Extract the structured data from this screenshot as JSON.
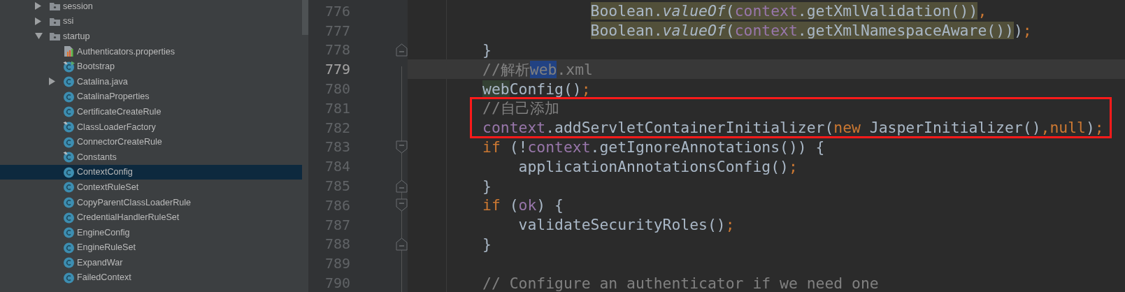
{
  "project_tree": [
    {
      "label": "session",
      "kind": "package",
      "expanded": false,
      "selected": false
    },
    {
      "label": "ssi",
      "kind": "package",
      "expanded": false,
      "selected": false
    },
    {
      "label": "startup",
      "kind": "package",
      "expanded": true,
      "selected": false,
      "children": [
        {
          "label": "Authenticators.properties",
          "kind": "properties",
          "selected": false
        },
        {
          "label": "Bootstrap",
          "kind": "main-class",
          "final": true,
          "selected": false
        },
        {
          "label": "Catalina.java",
          "kind": "class",
          "final": false,
          "expanded": false,
          "selected": false
        },
        {
          "label": "CatalinaProperties",
          "kind": "class",
          "final": false,
          "selected": false
        },
        {
          "label": "CertificateCreateRule",
          "kind": "class",
          "final": false,
          "selected": false
        },
        {
          "label": "ClassLoaderFactory",
          "kind": "class",
          "final": true,
          "selected": false
        },
        {
          "label": "ConnectorCreateRule",
          "kind": "class",
          "final": false,
          "selected": false
        },
        {
          "label": "Constants",
          "kind": "class",
          "final": true,
          "selected": false
        },
        {
          "label": "ContextConfig",
          "kind": "class",
          "final": false,
          "selected": true
        },
        {
          "label": "ContextRuleSet",
          "kind": "class",
          "final": false,
          "selected": false
        },
        {
          "label": "CopyParentClassLoaderRule",
          "kind": "class",
          "final": false,
          "selected": false
        },
        {
          "label": "CredentialHandlerRuleSet",
          "kind": "class",
          "final": false,
          "selected": false
        },
        {
          "label": "EngineConfig",
          "kind": "class",
          "final": false,
          "selected": false
        },
        {
          "label": "EngineRuleSet",
          "kind": "class",
          "final": false,
          "selected": false
        },
        {
          "label": "ExpandWar",
          "kind": "class",
          "final": false,
          "selected": false
        },
        {
          "label": "FailedContext",
          "kind": "class",
          "final": false,
          "selected": false
        }
      ]
    }
  ],
  "editor": {
    "lines": [
      {
        "number": "776",
        "current": false,
        "boxed": false,
        "segments": [
          {
            "t": "                    Boolean.",
            "kind": "plain",
            "color": "#52503a"
          },
          {
            "t": "valueOf",
            "kind": "static",
            "color": "#52503a"
          },
          {
            "t": "(",
            "kind": "plain",
            "color": "#52503a"
          },
          {
            "t": "context",
            "kind": "field",
            "color": "#52503a"
          },
          {
            "t": ".getXmlValidation())",
            "kind": "plain",
            "color": "#52503a"
          },
          {
            "t": ",",
            "kind": "punct"
          }
        ]
      },
      {
        "number": "777",
        "current": false,
        "boxed": false,
        "segments": [
          {
            "t": "                    Boolean.",
            "kind": "plain",
            "color": "#52503a"
          },
          {
            "t": "valueOf",
            "kind": "static",
            "color": "#52503a"
          },
          {
            "t": "(",
            "kind": "plain",
            "color": "#52503a"
          },
          {
            "t": "context",
            "kind": "field",
            "color": "#52503a"
          },
          {
            "t": ".getXmlNamespaceAware())",
            "kind": "plain",
            "color": "#52503a"
          },
          {
            "t": ")",
            "kind": "plain"
          },
          {
            "t": ";",
            "kind": "punct"
          }
        ]
      },
      {
        "number": "778",
        "current": false,
        "boxed": false,
        "kind": "fold-end",
        "segments": [
          {
            "t": "        }",
            "kind": "plain"
          }
        ]
      },
      {
        "number": "779",
        "current": true,
        "boxed": false,
        "segments": [
          {
            "t": "        //解析",
            "kind": "comment"
          },
          {
            "t": "web",
            "kind": "comment",
            "color": "#214283"
          },
          {
            "t": ".xml",
            "kind": "comment"
          }
        ]
      },
      {
        "number": "780",
        "current": false,
        "boxed": false,
        "segments": [
          {
            "t": "        web",
            "kind": "plain",
            "color": "#344134"
          },
          {
            "t": "Config()",
            "kind": "plain"
          },
          {
            "t": ";",
            "kind": "punct"
          }
        ]
      },
      {
        "number": "781",
        "current": false,
        "boxed": true,
        "segments": [
          {
            "t": "        //自己添加",
            "kind": "comment"
          }
        ]
      },
      {
        "number": "782",
        "current": false,
        "boxed": true,
        "segments": [
          {
            "t": "        context",
            "kind": "field"
          },
          {
            "t": ".addServletContainerInitializer(",
            "kind": "plain"
          },
          {
            "t": "new",
            "kind": "keyword"
          },
          {
            "t": " JasperInitializer()",
            "kind": "plain"
          },
          {
            "t": ",",
            "kind": "punct"
          },
          {
            "t": "null",
            "kind": "keyword"
          },
          {
            "t": ")",
            "kind": "plain"
          },
          {
            "t": ";",
            "kind": "punct"
          }
        ]
      },
      {
        "number": "783",
        "current": false,
        "boxed": false,
        "kind": "fold-start",
        "segments": [
          {
            "t": "        if",
            "kind": "keyword"
          },
          {
            "t": " (!",
            "kind": "plain"
          },
          {
            "t": "context",
            "kind": "field"
          },
          {
            "t": ".getIgnoreAnnotations()) {",
            "kind": "plain"
          }
        ]
      },
      {
        "number": "784",
        "current": false,
        "boxed": false,
        "segments": [
          {
            "t": "            applicationAnnotationsConfig()",
            "kind": "plain"
          },
          {
            "t": ";",
            "kind": "punct"
          }
        ]
      },
      {
        "number": "785",
        "current": false,
        "boxed": false,
        "kind": "fold-end",
        "segments": [
          {
            "t": "        }",
            "kind": "plain"
          }
        ]
      },
      {
        "number": "786",
        "current": false,
        "boxed": false,
        "kind": "fold-start",
        "segments": [
          {
            "t": "        if",
            "kind": "keyword"
          },
          {
            "t": " (",
            "kind": "plain"
          },
          {
            "t": "ok",
            "kind": "field"
          },
          {
            "t": ") {",
            "kind": "plain"
          }
        ]
      },
      {
        "number": "787",
        "current": false,
        "boxed": false,
        "segments": [
          {
            "t": "            validateSecurityRoles()",
            "kind": "plain"
          },
          {
            "t": ";",
            "kind": "punct"
          }
        ]
      },
      {
        "number": "788",
        "current": false,
        "boxed": false,
        "kind": "fold-end",
        "segments": [
          {
            "t": "        }",
            "kind": "plain"
          }
        ]
      },
      {
        "number": "789",
        "current": false,
        "boxed": false
      },
      {
        "number": "790",
        "current": false,
        "boxed": false,
        "segments": [
          {
            "t": "        // Configure an authenticator if we need one",
            "kind": "comment"
          }
        ]
      }
    ]
  }
}
